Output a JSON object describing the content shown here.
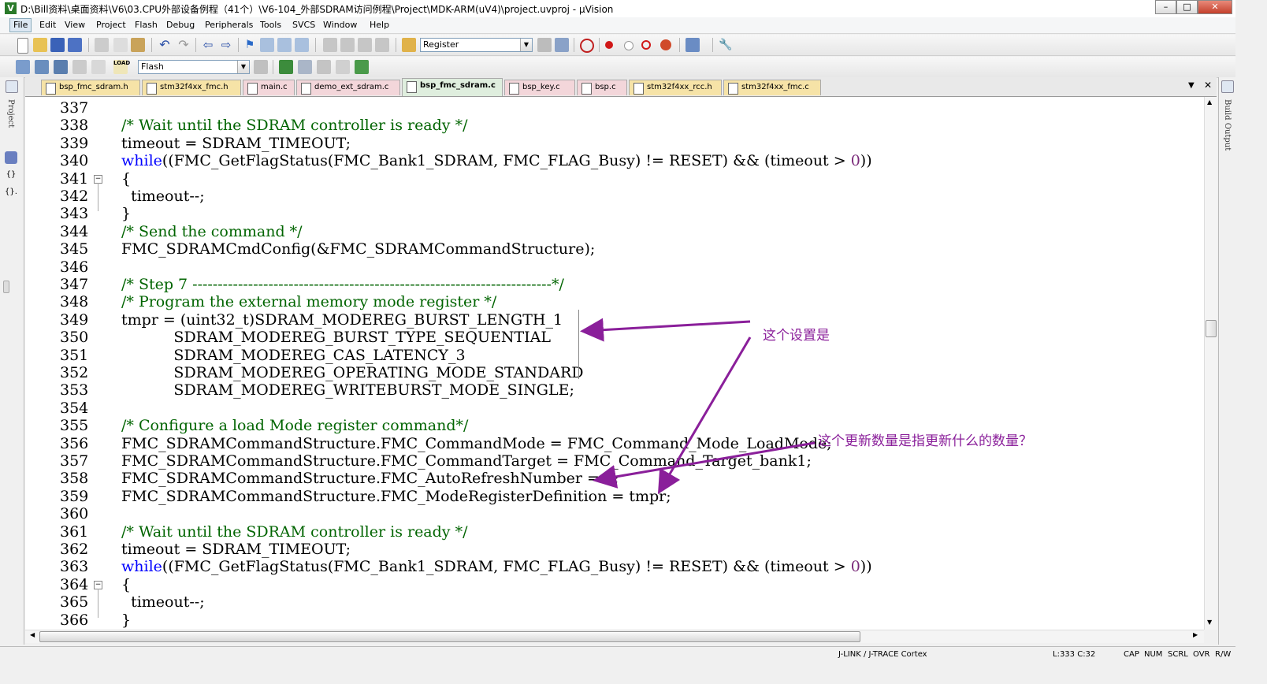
{
  "window": {
    "title": "D:\\Bill资料\\桌面资料\\V6\\03.CPU外部设备例程（41个）\\V6-104_外部SDRAM访问例程\\Project\\MDK-ARM(uV4)\\project.uvproj - µVision",
    "app_icon": "V",
    "minimize": "–",
    "maximize": "□",
    "close": "✕"
  },
  "menu": [
    "File",
    "Edit",
    "View",
    "Project",
    "Flash",
    "Debug",
    "Peripherals",
    "Tools",
    "SVCS",
    "Window",
    "Help"
  ],
  "toolbar1": {
    "find_combo": "Register"
  },
  "toolbar2": {
    "target_combo": "Flash"
  },
  "panels": {
    "left_label": "Project",
    "right_label": "Build Output"
  },
  "tabs": [
    {
      "label": "bsp_fmc_sdram.h",
      "kind": "h"
    },
    {
      "label": "stm32f4xx_fmc.h",
      "kind": "h"
    },
    {
      "label": "main.c",
      "kind": "c"
    },
    {
      "label": "demo_ext_sdram.c",
      "kind": "c"
    },
    {
      "label": "bsp_fmc_sdram.c",
      "kind": "c",
      "active": true
    },
    {
      "label": "bsp_key.c",
      "kind": "c"
    },
    {
      "label": "bsp.c",
      "kind": "c"
    },
    {
      "label": "stm32f4xx_rcc.h",
      "kind": "h"
    },
    {
      "label": "stm32f4xx_fmc.c",
      "kind": "c"
    }
  ],
  "tab_controls": {
    "dropdown": "▼",
    "close": "✕"
  },
  "code": [
    {
      "n": "337",
      "segs": []
    },
    {
      "n": "338",
      "segs": [
        [
          "cmt",
          "/* Wait until the SDRAM controller is ready */"
        ]
      ]
    },
    {
      "n": "339",
      "segs": [
        [
          "t",
          "timeout = SDRAM_TIMEOUT;"
        ]
      ]
    },
    {
      "n": "340",
      "segs": [
        [
          "kw",
          "while"
        ],
        [
          "t",
          "((FMC_GetFlagStatus(FMC_Bank1_SDRAM, FMC_FLAG_Busy) != RESET) && (timeout > "
        ],
        [
          "num",
          "0"
        ],
        [
          "t",
          "))"
        ]
      ]
    },
    {
      "n": "341",
      "fold": "−",
      "segs": [
        [
          "t",
          "{"
        ]
      ]
    },
    {
      "n": "342",
      "segs": [
        [
          "t",
          "  timeout--;"
        ]
      ]
    },
    {
      "n": "343",
      "segs": [
        [
          "t",
          "}"
        ]
      ]
    },
    {
      "n": "344",
      "segs": [
        [
          "cmt",
          "/* Send the command */"
        ]
      ]
    },
    {
      "n": "345",
      "segs": [
        [
          "t",
          "FMC_SDRAMCmdConfig(&FMC_SDRAMCommandStructure);"
        ]
      ]
    },
    {
      "n": "346",
      "segs": []
    },
    {
      "n": "347",
      "segs": [
        [
          "cmt",
          "/* Step 7 -----------------------------------------------------------------------*/"
        ]
      ]
    },
    {
      "n": "348",
      "segs": [
        [
          "cmt",
          "/* Program the external memory mode register */"
        ]
      ]
    },
    {
      "n": "349",
      "segs": [
        [
          "t",
          "tmpr = (uint32_t)SDRAM_MODEREG_BURST_LENGTH_1"
        ]
      ]
    },
    {
      "n": "350",
      "segs": [
        [
          "t",
          "           SDRAM_MODEREG_BURST_TYPE_SEQUENTIAL"
        ]
      ]
    },
    {
      "n": "351",
      "segs": [
        [
          "t",
          "           SDRAM_MODEREG_CAS_LATENCY_3"
        ]
      ]
    },
    {
      "n": "352",
      "segs": [
        [
          "t",
          "           SDRAM_MODEREG_OPERATING_MODE_STANDARD"
        ]
      ]
    },
    {
      "n": "353",
      "segs": [
        [
          "t",
          "           SDRAM_MODEREG_WRITEBURST_MODE_SINGLE;"
        ]
      ]
    },
    {
      "n": "354",
      "segs": []
    },
    {
      "n": "355",
      "segs": [
        [
          "cmt",
          "/* Configure a load Mode register command*/"
        ]
      ]
    },
    {
      "n": "356",
      "segs": [
        [
          "t",
          "FMC_SDRAMCommandStructure.FMC_CommandMode = FMC_Command_Mode_LoadMode;"
        ]
      ]
    },
    {
      "n": "357",
      "segs": [
        [
          "t",
          "FMC_SDRAMCommandStructure.FMC_CommandTarget = FMC_Command_Target_bank1;"
        ]
      ]
    },
    {
      "n": "358",
      "segs": [
        [
          "t",
          "FMC_SDRAMCommandStructure.FMC_AutoRefreshNumber = "
        ],
        [
          "num",
          "1"
        ],
        [
          "t",
          ";"
        ]
      ]
    },
    {
      "n": "359",
      "segs": [
        [
          "t",
          "FMC_SDRAMCommandStructure.FMC_ModeRegisterDefinition = tmpr;"
        ]
      ]
    },
    {
      "n": "360",
      "segs": []
    },
    {
      "n": "361",
      "segs": [
        [
          "cmt",
          "/* Wait until the SDRAM controller is ready */"
        ]
      ]
    },
    {
      "n": "362",
      "segs": [
        [
          "t",
          "timeout = SDRAM_TIMEOUT;"
        ]
      ]
    },
    {
      "n": "363",
      "segs": [
        [
          "kw",
          "while"
        ],
        [
          "t",
          "((FMC_GetFlagStatus(FMC_Bank1_SDRAM, FMC_FLAG_Busy) != RESET) && (timeout > "
        ],
        [
          "num",
          "0"
        ],
        [
          "t",
          "))"
        ]
      ]
    },
    {
      "n": "364",
      "fold": "−",
      "segs": [
        [
          "t",
          "{"
        ]
      ]
    },
    {
      "n": "365",
      "segs": [
        [
          "t",
          "  timeout--;"
        ]
      ]
    },
    {
      "n": "366",
      "segs": [
        [
          "t",
          "}"
        ]
      ]
    }
  ],
  "annotations": {
    "note1": "这个设置是",
    "note2": "这个更新数量是指更新什么的数量？",
    "color": "#8a1f9a"
  },
  "status": {
    "debugger": "J-LINK / J-TRACE Cortex",
    "position": "L:333 C:32",
    "caps": "CAP",
    "num": "NUM",
    "scrl": "SCRL",
    "ovr": "OVR",
    "rw": "R/W"
  }
}
